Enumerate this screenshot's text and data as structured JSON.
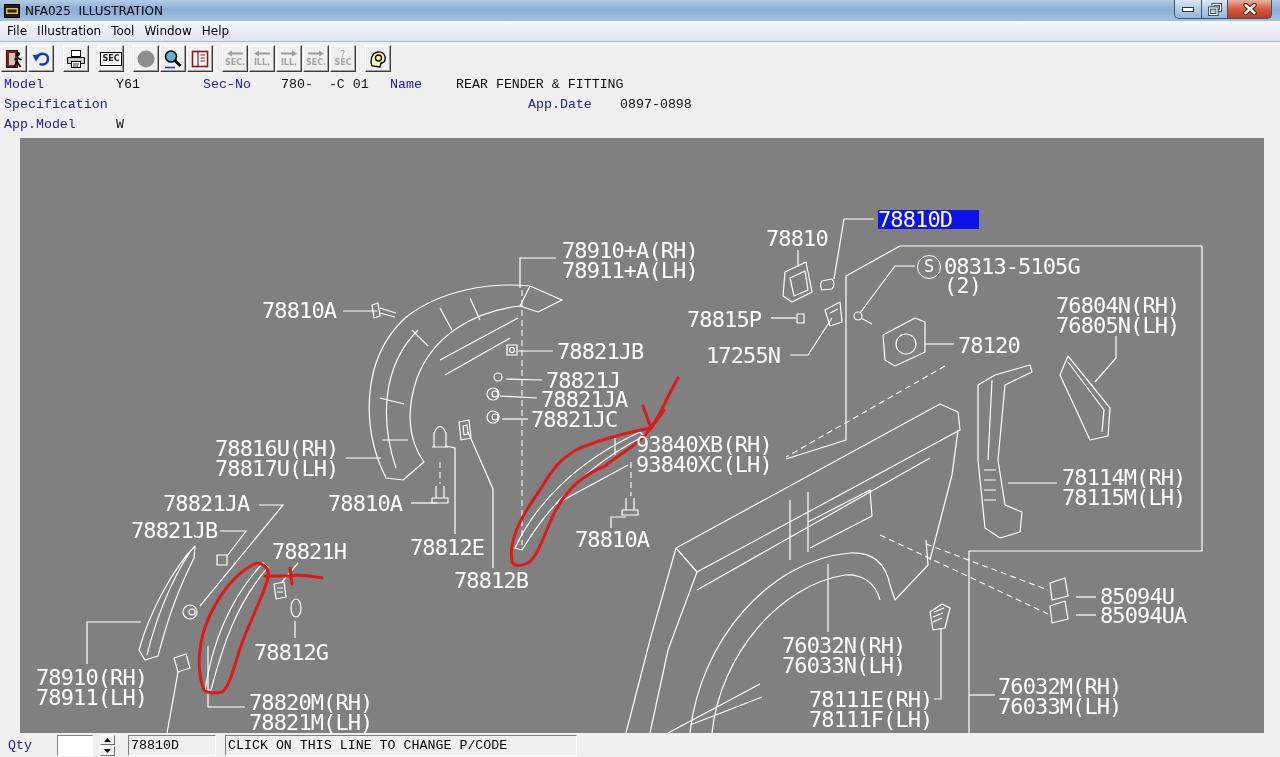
{
  "window": {
    "title": "NFA025  ILLUSTRATION"
  },
  "menu": [
    "File",
    "Illustration",
    "Tool",
    "Window",
    "Help"
  ],
  "toolbar": [
    {
      "kind": "exit",
      "disabled": false
    },
    {
      "kind": "undo",
      "disabled": false
    },
    {
      "kind": "print",
      "disabled": false
    },
    {
      "kind": "section",
      "label": "SEC",
      "disabled": false
    },
    {
      "kind": "circle",
      "disabled": false
    },
    {
      "kind": "zoom",
      "disabled": false
    },
    {
      "kind": "book",
      "disabled": false
    },
    {
      "kind": "back",
      "label": "SEC.",
      "disabled": true
    },
    {
      "kind": "back",
      "label": "ILL.",
      "disabled": true
    },
    {
      "kind": "forward",
      "label": "ILL.",
      "disabled": true
    },
    {
      "kind": "forward",
      "label": "SEC.",
      "disabled": true
    },
    {
      "kind": "query",
      "mark": "?",
      "label": "SEC",
      "disabled": true
    },
    {
      "kind": "help",
      "disabled": false
    }
  ],
  "header_rows": [
    [
      {
        "label": "Model",
        "value": "Y61"
      },
      {
        "label": "Sec-No",
        "value": "780-  -C 01"
      },
      {
        "label": "Name",
        "value": "REAR FENDER & FITTING"
      }
    ],
    [
      {
        "label": "Specification"
      },
      {
        "label": "App.Date",
        "value": "0897-0898"
      }
    ],
    [
      {
        "label": "App.Model",
        "value": "W"
      }
    ]
  ],
  "diagram": {
    "callouts": [
      {
        "text": "78810D",
        "selected": true
      },
      {
        "text": "78910+A(RH)",
        "selected": false
      },
      {
        "text": "78810",
        "selected": false
      },
      {
        "text": "78911+A(LH)",
        "selected": false
      },
      {
        "text": "08313-5105G",
        "prefix": "S",
        "quantity": "(2)",
        "selected": false
      },
      {
        "text": "78810A",
        "selected": false
      },
      {
        "text": "78815P",
        "selected": false
      },
      {
        "text": "76804N(RH)",
        "selected": false
      },
      {
        "text": "76805N(LH)",
        "selected": false
      },
      {
        "text": "78821JB",
        "selected": false
      },
      {
        "text": "17255N",
        "selected": false
      },
      {
        "text": "78120",
        "selected": false
      },
      {
        "text": "78821J",
        "selected": false
      },
      {
        "text": "78821JA",
        "selected": false
      },
      {
        "text": "78821JC",
        "selected": false
      },
      {
        "text": "78816U(RH)",
        "selected": false
      },
      {
        "text": "93840XB(RH)",
        "selected": false
      },
      {
        "text": "78817U(LH)",
        "selected": false
      },
      {
        "text": "93840XC(LH)",
        "selected": false
      },
      {
        "text": "78114M(RH)",
        "selected": false
      },
      {
        "text": "78821JA",
        "selected": false
      },
      {
        "text": "78810A",
        "selected": false
      },
      {
        "text": "78115M(LH)",
        "selected": false
      },
      {
        "text": "78821JB",
        "selected": false
      },
      {
        "text": "78821H",
        "selected": false
      },
      {
        "text": "78812E",
        "selected": false
      },
      {
        "text": "78810A",
        "selected": false
      },
      {
        "text": "78812B",
        "selected": false
      },
      {
        "text": "85094U",
        "selected": false
      },
      {
        "text": "85094UA",
        "selected": false
      },
      {
        "text": "78812G",
        "selected": false
      },
      {
        "text": "76032N(RH)",
        "selected": false
      },
      {
        "text": "78910(RH)",
        "selected": false
      },
      {
        "text": "76033N(LH)",
        "selected": false
      },
      {
        "text": "78911(LH)",
        "selected": false
      },
      {
        "text": "78820M(RH)",
        "selected": false
      },
      {
        "text": "78111E(RH)",
        "selected": false
      },
      {
        "text": "76032M(RH)",
        "selected": false
      },
      {
        "text": "78821M(LH)",
        "selected": false
      },
      {
        "text": "78111F(LH)",
        "selected": false
      },
      {
        "text": "76033M(LH)",
        "selected": false
      }
    ]
  },
  "status_bar": {
    "qty": {
      "label": "Qty"
    },
    "part_code": "78810D",
    "message": "CLICK ON THIS LINE TO CHANGE P/CODE"
  }
}
